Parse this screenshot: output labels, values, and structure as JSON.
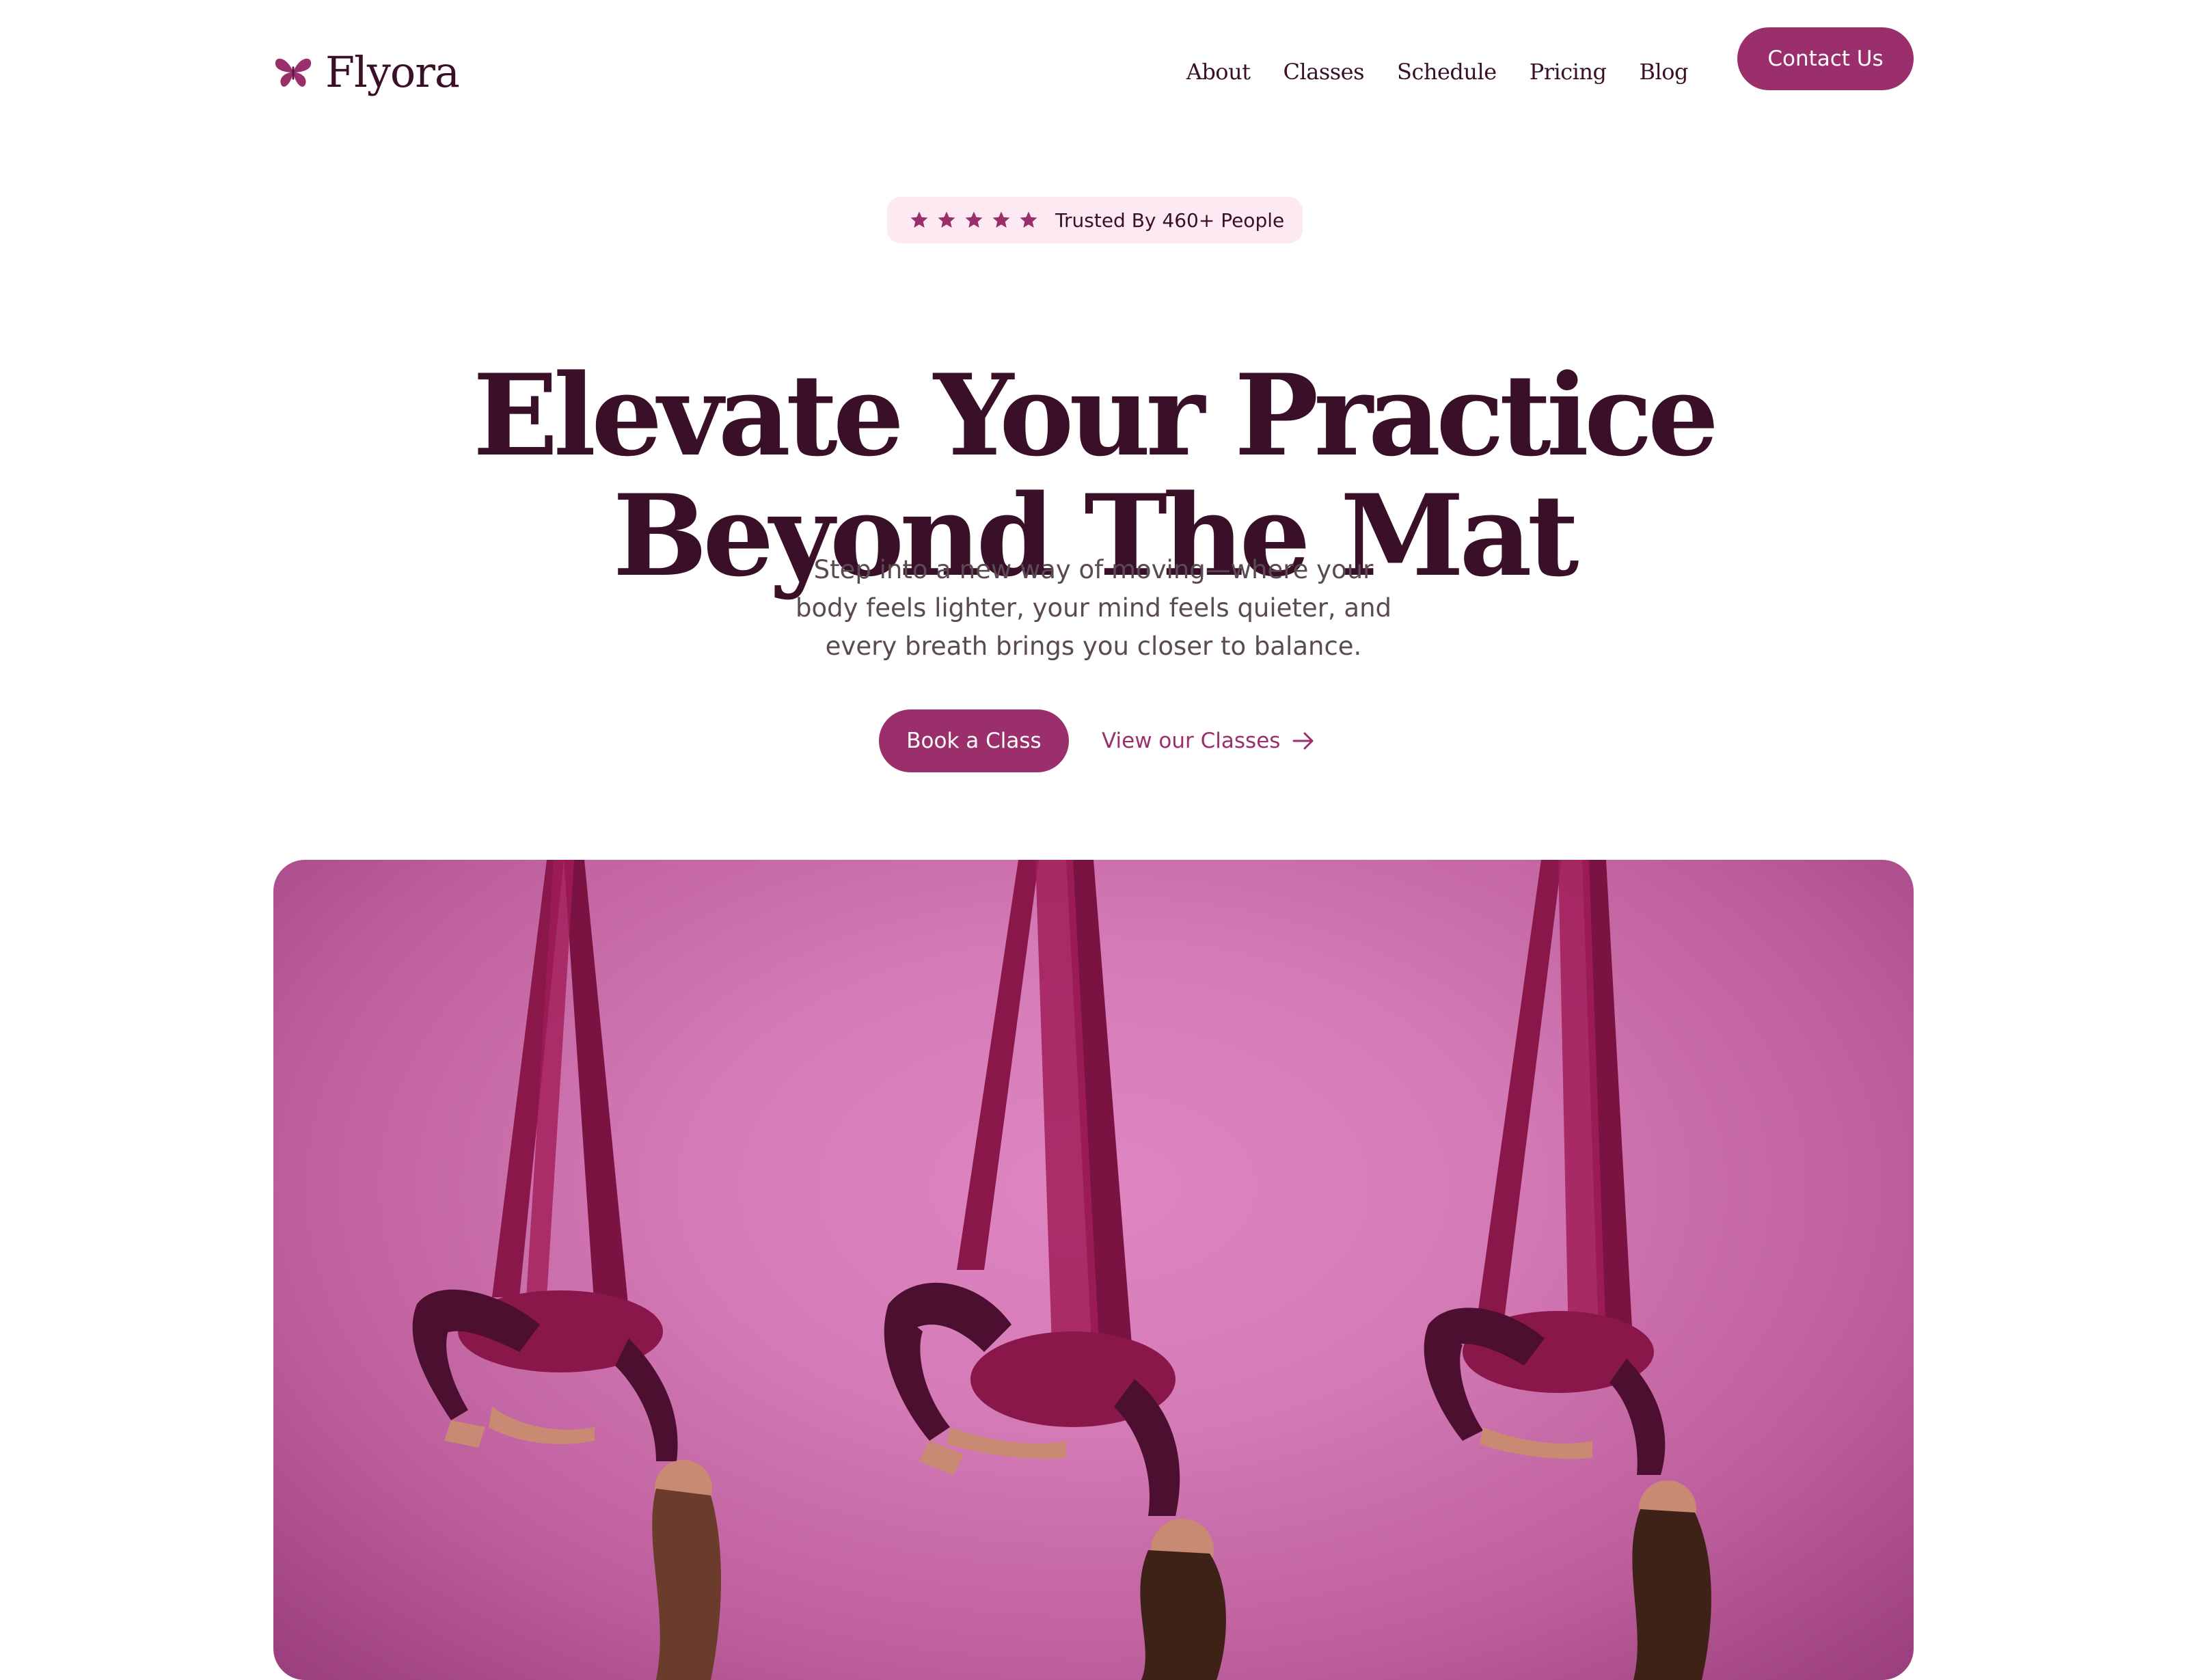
{
  "brand": {
    "name": "Flyora",
    "icon": "butterfly-icon"
  },
  "nav": {
    "links": [
      "About",
      "Classes",
      "Schedule",
      "Pricing",
      "Blog"
    ],
    "contact_label": "Contact Us"
  },
  "trust": {
    "stars": 5,
    "text": "Trusted By 460+ People",
    "star_icon": "star-icon"
  },
  "hero": {
    "headline_line1": "Elevate Your Practice",
    "headline_line2": "Beyond The Mat",
    "subtitle_line1": "Step into a new way of moving—where your",
    "subtitle_line2": "body feels lighter, your mind feels quieter, and",
    "subtitle_line3": "every breath brings you closer to balance.",
    "primary_cta": "Book a Class",
    "secondary_cta": "View our Classes",
    "secondary_icon": "arrow-right-icon"
  },
  "colors": {
    "accent": "#9b2f6c",
    "heading": "#3a1028",
    "badge_bg": "#fde9f1",
    "photo_bg": "#d47ab6",
    "silk": "#8a1749"
  }
}
